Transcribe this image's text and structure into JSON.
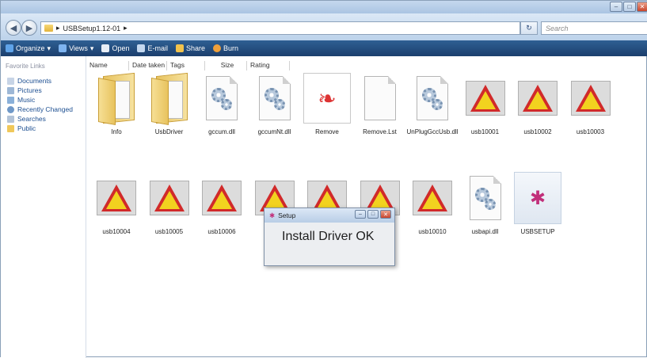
{
  "address": {
    "crumb": "USBSetup1.12-01",
    "search_placeholder": "Search"
  },
  "toolbar": {
    "items": [
      "Organize",
      "Views",
      "Open",
      "E-mail",
      "Share",
      "Burn"
    ]
  },
  "sidebar": {
    "title": "Favorite Links",
    "items": [
      "Documents",
      "Pictures",
      "Music",
      "Recently Changed",
      "Searches",
      "Public"
    ]
  },
  "columns": [
    "Name",
    "Date taken",
    "Tags",
    "Size",
    "Rating"
  ],
  "files": [
    {
      "name": "Info",
      "type": "folder"
    },
    {
      "name": "UsbDriver",
      "type": "folder"
    },
    {
      "name": "gccum.dll",
      "type": "dll"
    },
    {
      "name": "gccumNt.dll",
      "type": "dll"
    },
    {
      "name": "Remove",
      "type": "remove"
    },
    {
      "name": "Remove.Lst",
      "type": "text"
    },
    {
      "name": "UnPlugGccUsb.dll",
      "type": "dll"
    },
    {
      "name": "usb10001",
      "type": "usb"
    },
    {
      "name": "usb10002",
      "type": "usb"
    },
    {
      "name": "usb10003",
      "type": "usb"
    },
    {
      "name": "usb10004",
      "type": "usb"
    },
    {
      "name": "usb10005",
      "type": "usb"
    },
    {
      "name": "usb10006",
      "type": "usb"
    },
    {
      "name": "u",
      "type": "usb"
    },
    {
      "name": "",
      "type": "usb"
    },
    {
      "name": "",
      "type": "usb"
    },
    {
      "name": "usb10010",
      "type": "usb"
    },
    {
      "name": "usbapi.dll",
      "type": "dll"
    },
    {
      "name": "USBSETUP",
      "type": "setup"
    }
  ],
  "dialog": {
    "title": "Setup",
    "message": "Install Driver OK"
  }
}
